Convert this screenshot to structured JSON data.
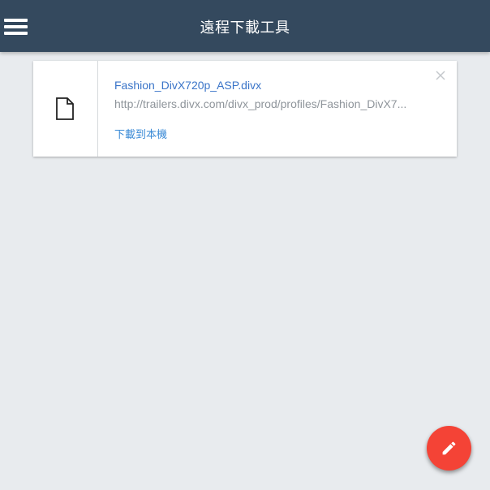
{
  "header": {
    "menu_icon": "hamburger-menu-icon",
    "title": "遠程下載工具",
    "background": "#34495e"
  },
  "download_list": [
    {
      "icon": "file-icon",
      "file_name": "Fashion_DivX720p_ASP.divx",
      "url": "http://trailers.divx.com/divx_prod/profiles/Fashion_DivX7...",
      "action_label": "下載到本機",
      "close_icon": "close-icon"
    }
  ],
  "fab": {
    "icon": "pencil-icon",
    "color": "#f44336"
  },
  "colors": {
    "link": "#3a74c8",
    "page_background": "#e8ebee"
  }
}
